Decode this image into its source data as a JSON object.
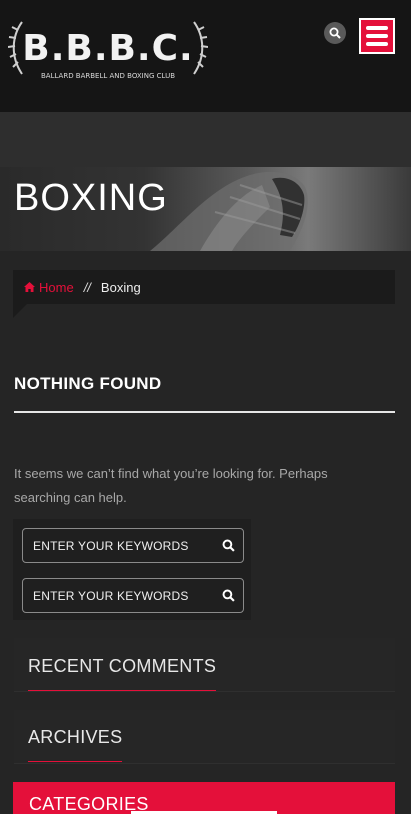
{
  "brand": {
    "logo_text": "B.B.B.C.",
    "logo_subtitle": "BALLARD BARBELL AND BOXING CLUB"
  },
  "header": {
    "search_icon": "search-icon",
    "menu_icon": "hamburger-menu-icon"
  },
  "hero": {
    "title": "BOXING"
  },
  "breadcrumb": {
    "home_label": "Home",
    "separator": "//",
    "current": "Boxing"
  },
  "content": {
    "title": "NOTHING FOUND",
    "message": "It seems we can’t find what you’re looking for. Perhaps searching can help."
  },
  "search": {
    "field1_placeholder": "ENTER YOUR KEYWORDS",
    "field2_placeholder": "ENTER YOUR KEYWORDS"
  },
  "widgets": {
    "recent_comments": "RECENT COMMENTS",
    "archives": "ARCHIVES",
    "categories": "CATEGORIES"
  },
  "colors": {
    "accent": "#e4103a",
    "background": "#252525",
    "header_bg": "#151515"
  }
}
